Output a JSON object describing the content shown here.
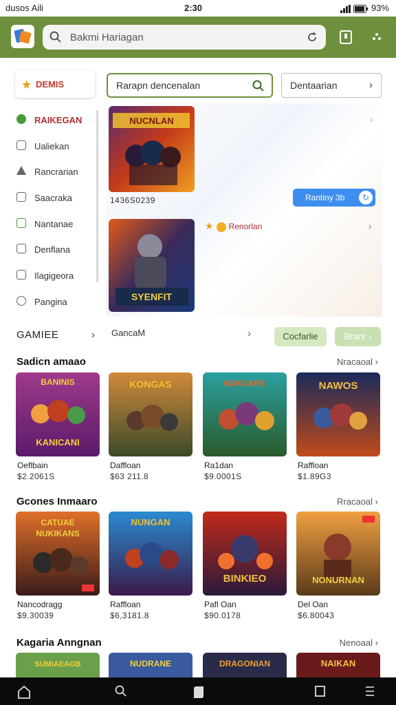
{
  "status_bar": {
    "left": "dusos Aili",
    "time": "2:30",
    "battery": "93%"
  },
  "header": {
    "search_placeholder": "Bakmi Hariagan"
  },
  "sidebar": {
    "header": "DEMIS",
    "items": [
      {
        "label": "RAIKEGAN"
      },
      {
        "label": "Ualiekan"
      },
      {
        "label": "Rancrarian"
      },
      {
        "label": "Saacraka"
      },
      {
        "label": "Nantanae"
      },
      {
        "label": "Denflana"
      },
      {
        "label": "Ilagigeora"
      },
      {
        "label": "Pangina"
      }
    ],
    "games_label": "GAMIEE"
  },
  "filters": {
    "search_text": "Rarapn dencenalan",
    "select_text": "Dentaarian"
  },
  "featured": {
    "caption": "1436S0239",
    "button_label": "Rantiny 3b",
    "row2_label": "Renorlan",
    "game_center_label": "GancaM",
    "btn1": "Cocfarlie",
    "btn2": "Branr"
  },
  "sections": [
    {
      "title": "Sadicn amaao",
      "more": "Nracaoal",
      "cards": [
        {
          "name": "Oeflbain",
          "price": "$2.2061S"
        },
        {
          "name": "Daffloan",
          "price": "$63 211.8"
        },
        {
          "name": "Ra1dan",
          "price": "$9.0001S"
        },
        {
          "name": "Raffloan",
          "price": "$1.89G3"
        }
      ]
    },
    {
      "title": "Gcones Inmaaro",
      "more": "Rracaoal",
      "cards": [
        {
          "name": "Nancodragg",
          "price": "$9.30039"
        },
        {
          "name": "Raffloan",
          "price": "$6,3181.8"
        },
        {
          "name": "Pafl Oan",
          "price": "$90.0178"
        },
        {
          "name": "Del Oan",
          "price": "$6.80043"
        }
      ]
    },
    {
      "title": "Kagaria Anngnan",
      "more": "Nenoaal",
      "cards": [
        {},
        {},
        {},
        {}
      ]
    }
  ],
  "thumb_banners": {
    "f1": "NUCNLAN",
    "f2": "SYENFIT",
    "s1": [
      "BANINIS",
      "KANICANI"
    ],
    "s2": [
      "KONGAS"
    ],
    "s3": [
      "NAKGARS"
    ],
    "s4": [
      "NAWOS"
    ],
    "g1": [
      "CATUAE",
      "NUKIKANS"
    ],
    "g2": [
      "NUNGAN"
    ],
    "g3": [
      "BINKIEO"
    ],
    "g4": [
      "NONURNAN"
    ],
    "k1": [
      "SUMIAEAGB"
    ],
    "k2": [
      "NUDRANE"
    ],
    "k3": [
      "DRAGONIAN"
    ],
    "k4": [
      "NAIKAN"
    ]
  },
  "colors": {
    "header_green": "#6e8f3c",
    "accent_red": "#c0392b",
    "button_blue": "#3d8ef0",
    "nav_black": "#0b0b0b"
  }
}
